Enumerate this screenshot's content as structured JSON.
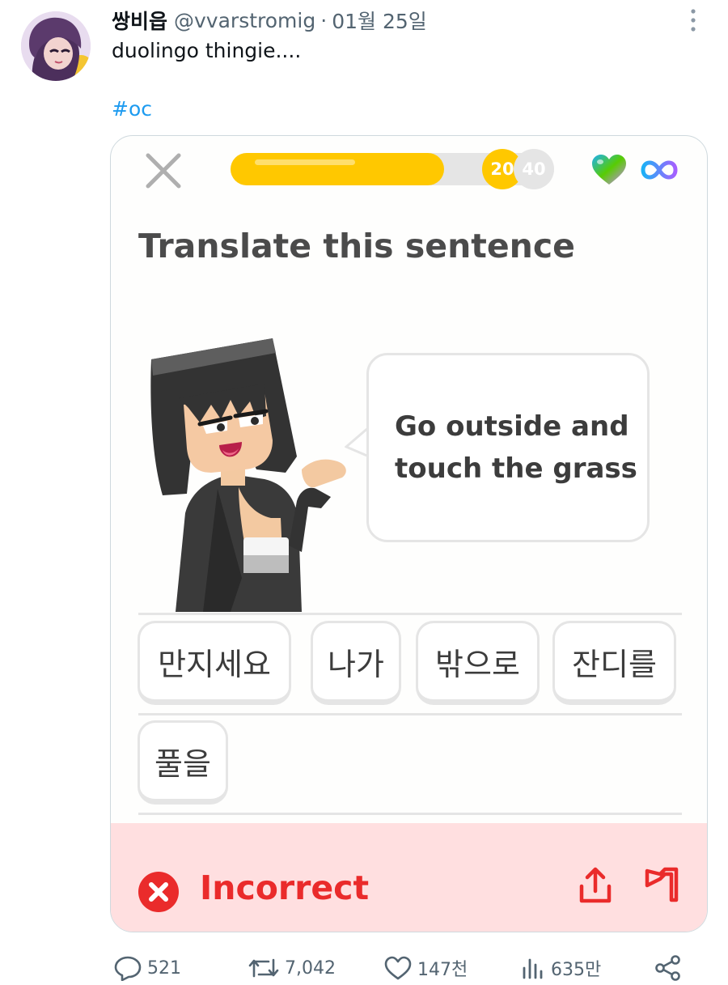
{
  "tweet": {
    "display_name": "쌍비읍",
    "handle": "@vvarstromig",
    "separator": "·",
    "date": "01월 25일",
    "text": "duolingo thingie....",
    "hashtag": "#oc"
  },
  "lesson": {
    "progress_fraction": 0.66,
    "progress_markers": [
      "20",
      "40"
    ],
    "prompt": "Translate this sentence",
    "speech_line_1": "Go outside and",
    "speech_line_2": "touch the grass",
    "word_bank": [
      "만지세요",
      "나가",
      "밖으로",
      "잔디를",
      "풀을"
    ],
    "result": "Incorrect",
    "colors": {
      "progress": "#ffc800",
      "incorrect": "#ea2b2b",
      "feedback_bg": "#ffdfe0"
    }
  },
  "actions": {
    "replies": "521",
    "reposts": "7,042",
    "likes": "147천",
    "views": "635만"
  },
  "icons": [
    "more-icon",
    "close-icon",
    "heart-icon",
    "infinity-icon",
    "x-circle-icon",
    "share-icon",
    "flag-icon",
    "reply-icon",
    "repost-icon",
    "like-icon",
    "views-icon",
    "share-network-icon"
  ]
}
